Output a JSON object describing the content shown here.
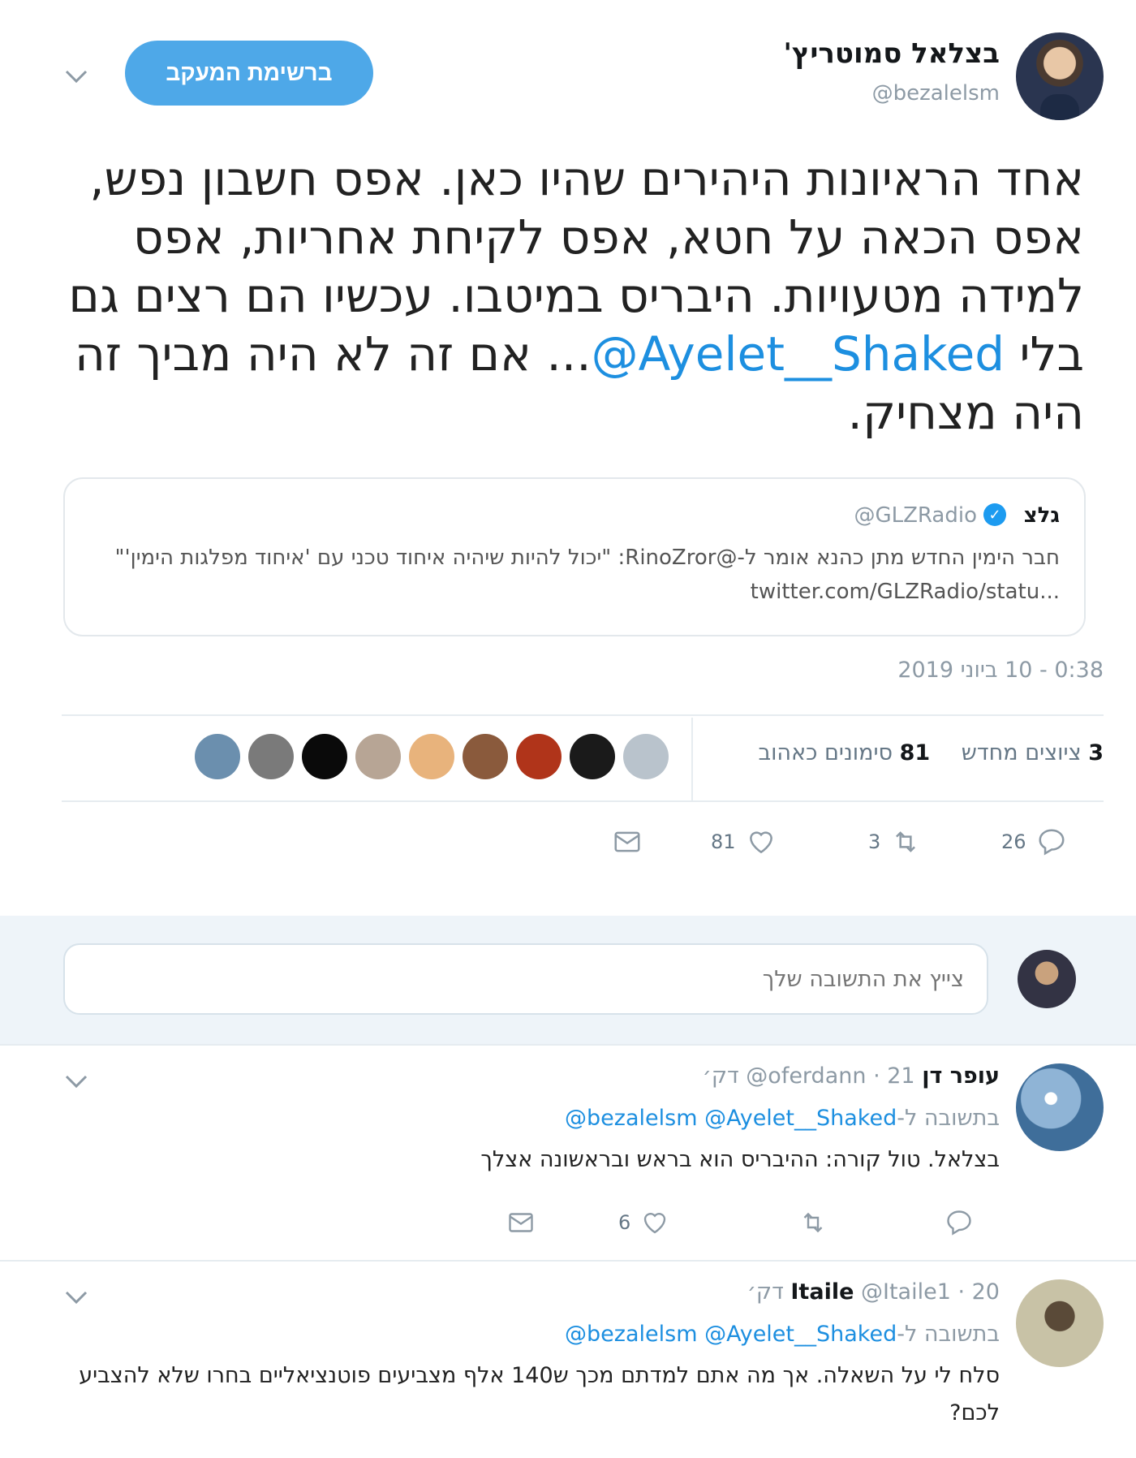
{
  "tweet": {
    "author_name": "בצלאל סמוטריץ'",
    "author_handle": "@bezalelsm",
    "follow_button": "ברשימת המעקב",
    "text_before_mention": "אחד הראיונות היהירים שהיו כאן. אפס חשבון נפש, אפס הכאה על חטא, אפס לקיחת אחריות, אפס למידה מטעויות. היבריס במיטבו. עכשיו הם רצים גם בלי",
    "mention": "@Ayelet__Shaked",
    "text_after_mention": "... אם זה לא היה מביך זה היה מצחיק.",
    "quote": {
      "name": "גלצ",
      "handle": "@GLZRadio",
      "text": "חבר הימין החדש מתן כהנא אומר ל-@RinoZror: \"יכול להיות שיהיה איחוד טכני עם 'איחוד מפלגות הימין'\" ...twitter.com/GLZRadio/statu"
    },
    "timestamp": "0:38 - 10 ביוני 2019",
    "retweets_count": "3",
    "retweets_label": "ציוצים מחדש",
    "likes_count": "81",
    "likes_label": "סימונים כאהוב",
    "actions": {
      "reply_count": "26",
      "retweet_count": "3",
      "like_count": "81"
    },
    "likers": [
      "#6b8fae",
      "#7a7a7a",
      "#0a0a0a",
      "#b7a595",
      "#e8b37c",
      "#8a5a3c",
      "#b0341a",
      "#1a1a1a",
      "#b9c3cc"
    ]
  },
  "reply_composer": {
    "placeholder": "צייץ את התשובה שלך"
  },
  "replies": [
    {
      "name": "עופר דן",
      "handle": "@oferdann",
      "time": "· 21 דק׳",
      "in_reply_label": "בתשובה ל-",
      "in_reply_mentions": "@bezalelsm @Ayelet__Shaked",
      "text": "בצלאל. טול קורה: ההיבריס הוא בראש ובראשונה אצלך",
      "reply_count": "",
      "retweet_count": "",
      "like_count": "6"
    },
    {
      "name": "Itaile",
      "handle": "@Itaile1",
      "time": "· 20 דק׳",
      "in_reply_label": "בתשובה ל-",
      "in_reply_mentions": "@bezalelsm @Ayelet__Shaked",
      "text": "סלח לי על השאלה. אך מה אתם למדתם מכך ש140 אלף מצביעים פוטנציאליים בחרו שלא להצביע לכם?"
    }
  ]
}
